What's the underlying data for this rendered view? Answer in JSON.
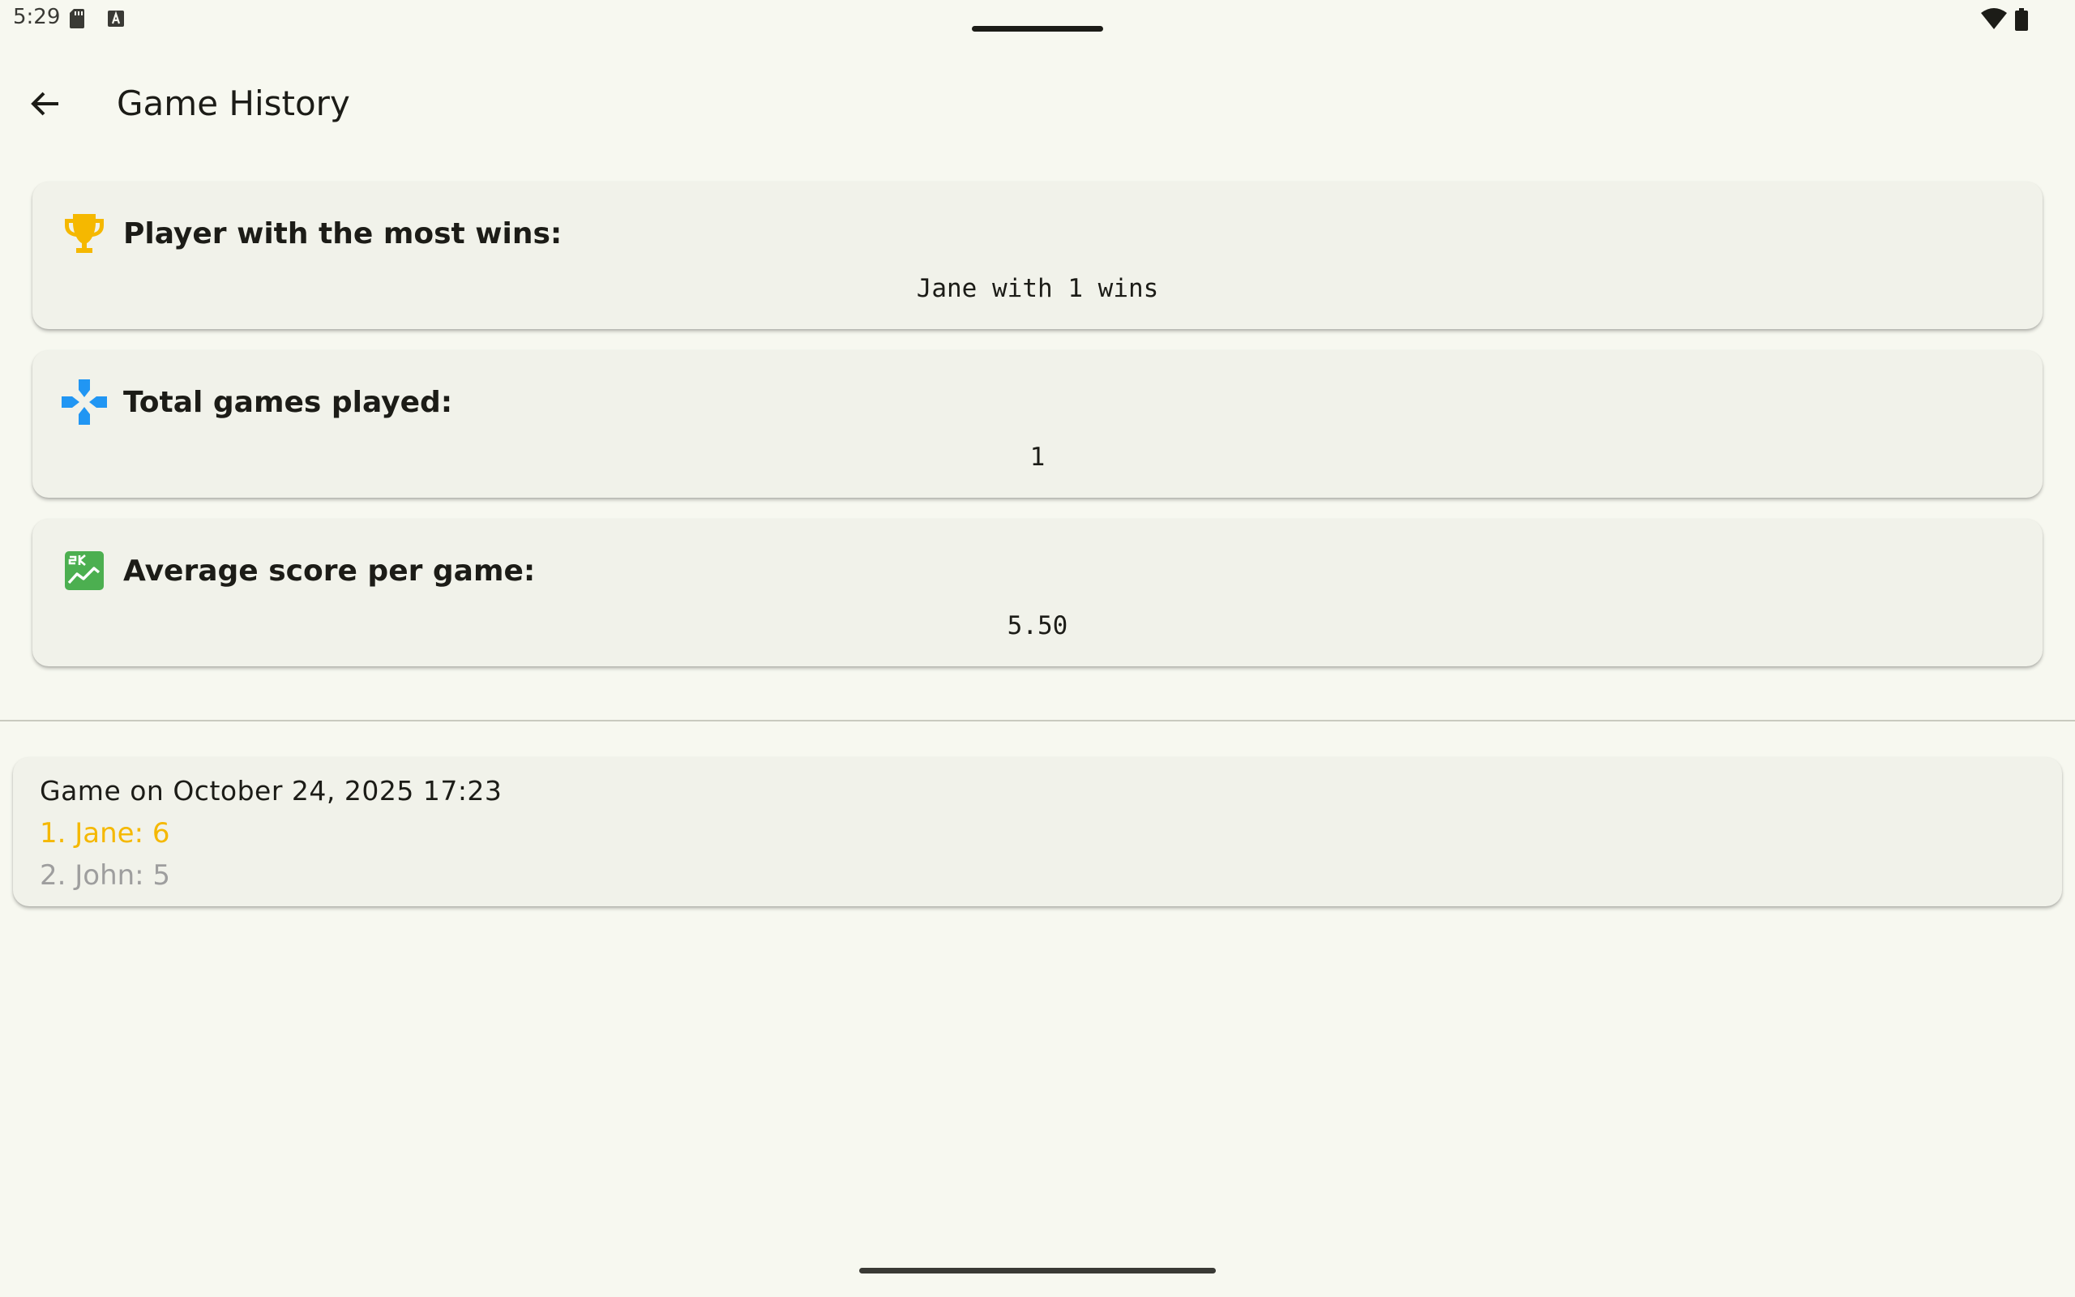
{
  "status_bar": {
    "time": "5:29",
    "icons": [
      "sd-card-icon",
      "keyboard-a-icon",
      "wifi-icon",
      "battery-icon"
    ]
  },
  "app_bar": {
    "back_icon": "arrow-back-icon",
    "title": "Game History"
  },
  "stats": [
    {
      "icon": "trophy-icon",
      "icon_color": "#f5b800",
      "label": "Player with the most wins:",
      "value": "Jane with 1 wins"
    },
    {
      "icon": "gamepad-icon",
      "icon_color": "#2196f3",
      "label": "Total games played:",
      "value": "1"
    },
    {
      "icon": "score-chart-icon",
      "icon_color": "#4caf50",
      "label": "Average score per game:",
      "value": "5.50"
    }
  ],
  "games": [
    {
      "date_label": "Game on October 24, 2025 17:23",
      "results": [
        {
          "text": "1. Jane: 6",
          "color": "#f5b800"
        },
        {
          "text": "2. John: 5",
          "color": "#9e9e9e"
        }
      ]
    }
  ]
}
